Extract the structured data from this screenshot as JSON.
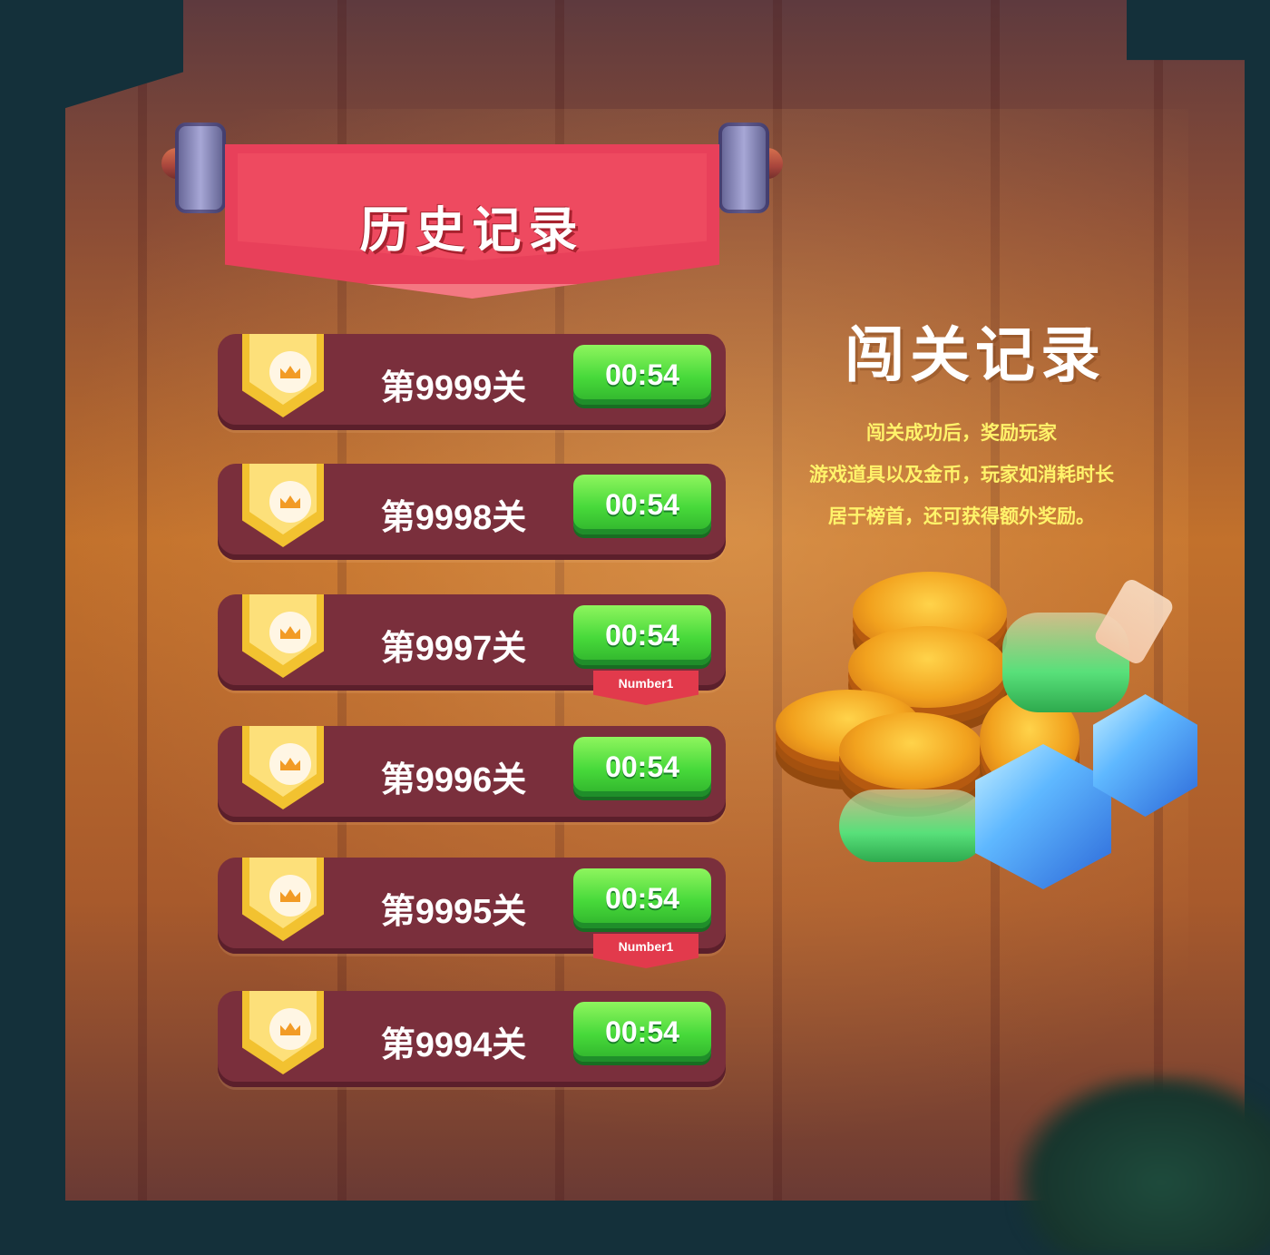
{
  "banner": {
    "title": "历史记录"
  },
  "records": [
    {
      "level": "第9999关",
      "time": "00:54",
      "badge": ""
    },
    {
      "level": "第9998关",
      "time": "00:54",
      "badge": ""
    },
    {
      "level": "第9997关",
      "time": "00:54",
      "badge": "Number1"
    },
    {
      "level": "第9996关",
      "time": "00:54",
      "badge": ""
    },
    {
      "level": "第9995关",
      "time": "00:54",
      "badge": "Number1"
    },
    {
      "level": "第9994关",
      "time": "00:54",
      "badge": ""
    }
  ],
  "side": {
    "title": "闯关记录",
    "lines": [
      "闯关成功后，奖励玩家",
      "游戏道具以及金币，玩家如消耗时长",
      "居于榜首，还可获得额外奖励。"
    ]
  },
  "colors": {
    "banner_red": "#e8405a",
    "row_bg": "#7a2f3c",
    "time_green": "#47d93a",
    "medal_gold": "#f2c230",
    "desc_yellow": "#fff36a"
  },
  "icons": [
    "crown-icon",
    "medal-icon",
    "coin-icon",
    "gem-icon",
    "potion-icon"
  ]
}
